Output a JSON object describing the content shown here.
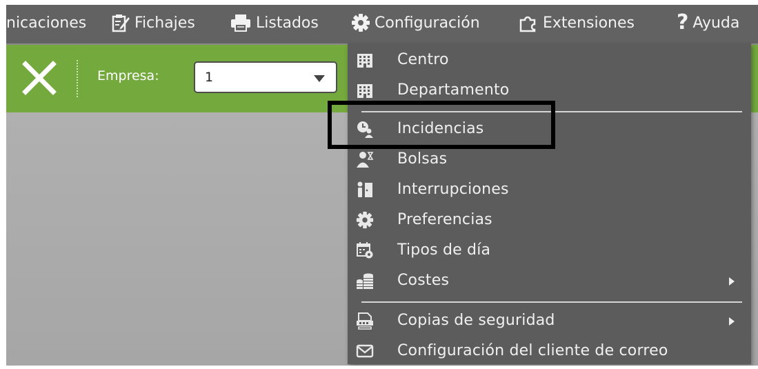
{
  "menubar": {
    "items": [
      {
        "label": "nicaciones",
        "icon": "none"
      },
      {
        "label": "Fichajes",
        "icon": "clipboard-pen-icon"
      },
      {
        "label": "Listados",
        "icon": "printer-icon"
      },
      {
        "label": "Configuración",
        "icon": "gear-icon"
      },
      {
        "label": "Extensiones",
        "icon": "puzzle-icon"
      },
      {
        "label": "Ayuda",
        "icon": "question-icon"
      }
    ]
  },
  "toolbar": {
    "close_icon": "close-icon",
    "empresa_label": "Empresa:",
    "empresa_value": "1"
  },
  "dropdown": {
    "items": [
      {
        "label": "Centro",
        "icon": "building-icon"
      },
      {
        "label": "Departamento",
        "icon": "building-icon"
      },
      {
        "label": "Incidencias",
        "icon": "clock-user-icon"
      },
      {
        "label": "Bolsas",
        "icon": "user-hourglass-icon"
      },
      {
        "label": "Interrupciones",
        "icon": "person-door-icon"
      },
      {
        "label": "Preferencias",
        "icon": "gear-icon"
      },
      {
        "label": "Tipos de día",
        "icon": "calendar-gear-icon"
      },
      {
        "label": "Costes",
        "icon": "coins-icon",
        "submenu": true
      },
      {
        "label": "Copias de seguridad",
        "icon": "backup-icon",
        "submenu": true
      },
      {
        "label": "Configuración del cliente de correo",
        "icon": "envelope-icon"
      }
    ]
  },
  "colors": {
    "menubar": "#626262",
    "toolbar": "#74a93d",
    "dropdown": "#5c5c5c",
    "workspace": "#ababab",
    "highlight": "#000000"
  }
}
